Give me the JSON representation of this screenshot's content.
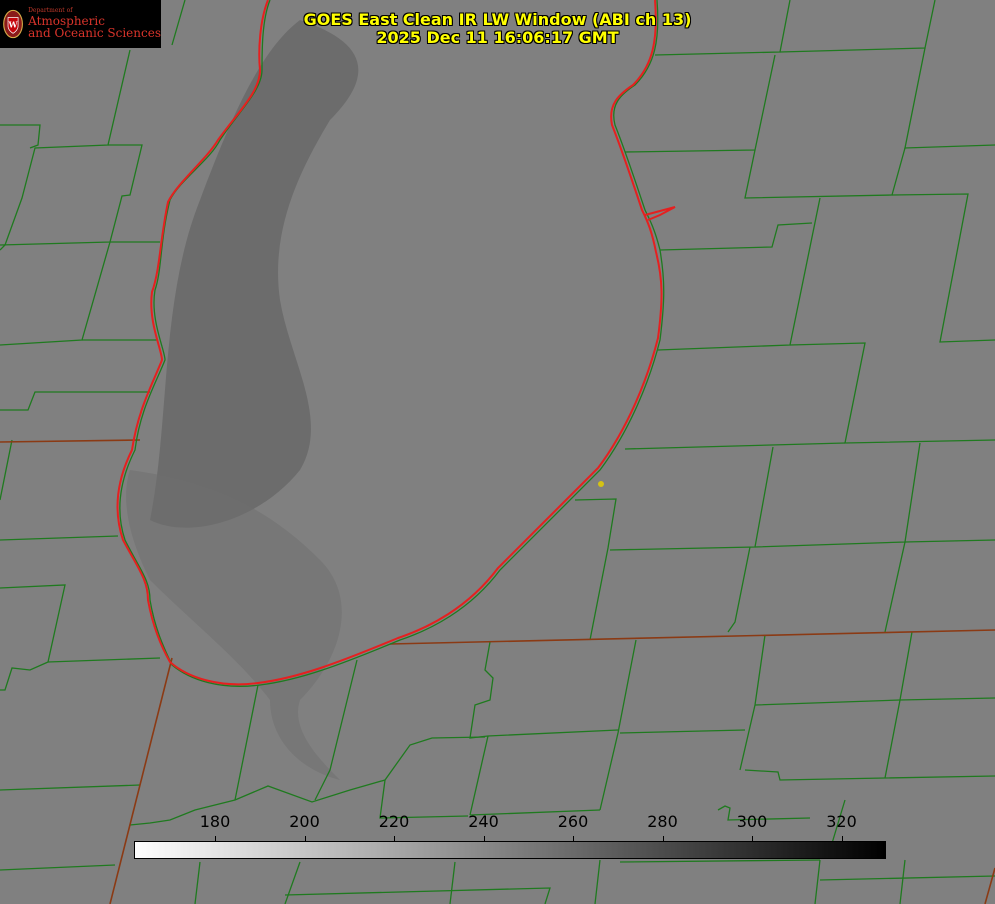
{
  "logo": {
    "department": "Department of",
    "line1": "Atmospheric",
    "line2": "and Oceanic Sciences"
  },
  "title": {
    "line1": "GOES East Clean IR LW Window (ABI ch 13)",
    "line2": "2025 Dec 11 16:06:17 GMT"
  },
  "colorbar": {
    "ticks": [
      "180",
      "200",
      "220",
      "240",
      "260",
      "280",
      "300",
      "320"
    ],
    "gradient_from": "#ffffff",
    "gradient_to": "#000000"
  },
  "colors": {
    "background": "#7f7f7f",
    "county_lines": "#1f7a1f",
    "state_lines": "#8b3a14",
    "lake_shore": "#e52020",
    "title_text": "#ffff00",
    "marker": "#d4c214"
  }
}
